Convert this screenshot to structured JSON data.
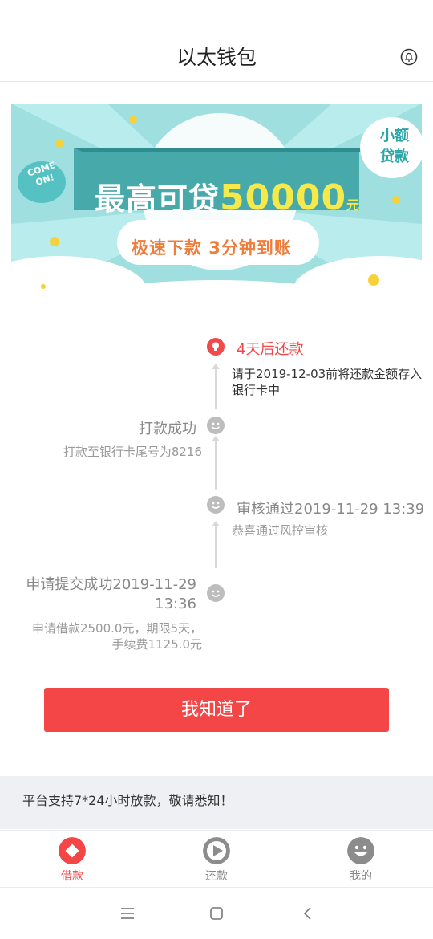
{
  "header": {
    "title": "以太钱包",
    "bell_icon": "bell-icon"
  },
  "banner": {
    "line1_prefix": "最高可贷",
    "line1_amount": "50000",
    "line1_unit": "元",
    "line2": "极速下款  3分钟到账",
    "tag_line1": "小额",
    "tag_line2": "贷款",
    "come_on_line1": "COME",
    "come_on_line2": "ON!"
  },
  "timeline": {
    "current": {
      "title": "4天后还款",
      "desc": "请于2019-12-03前将还款金额存入银行卡中"
    },
    "step_payout": {
      "title": "打款成功",
      "desc": "打款至银行卡尾号为8216"
    },
    "step_review": {
      "title": "审核通过2019-11-29 13:39",
      "desc": "恭喜通过风控审核"
    },
    "step_apply": {
      "title_line1": "申请提交成功2019-11-29",
      "title_line2": "13:36",
      "desc_line1": "申请借款2500.0元，期限5天，",
      "desc_line2": "手续费1125.0元"
    }
  },
  "confirm_button": "我知道了",
  "notice": "平台支持7*24小时放款，敬请悉知！",
  "tabs": [
    {
      "label": "借款",
      "icon": "diamond-icon",
      "active": true
    },
    {
      "label": "还款",
      "icon": "play-icon",
      "active": false
    },
    {
      "label": "我的",
      "icon": "smiley-icon",
      "active": false
    }
  ],
  "colors": {
    "accent": "#f44646",
    "inactive": "#888888",
    "banner_bg": "#a8e4e4"
  }
}
